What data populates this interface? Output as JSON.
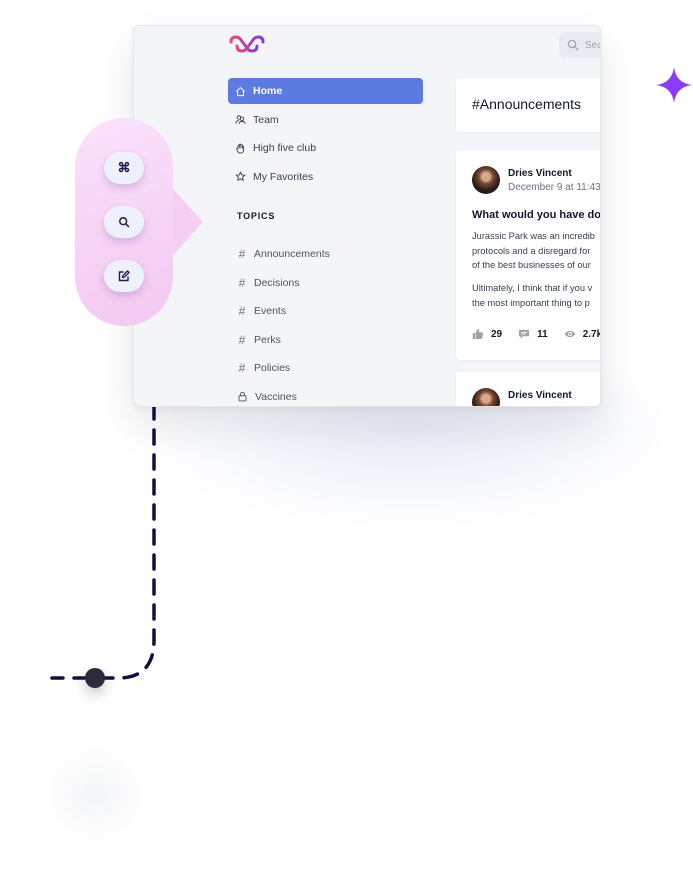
{
  "brand": {
    "logo_icon": "heart-chain-logo",
    "accent": "#5b7be0",
    "sparkle_color": "#8b3cf7"
  },
  "search": {
    "placeholder": "Sea",
    "icon": "search-icon"
  },
  "nav": {
    "items": [
      {
        "label": "Home",
        "icon": "home-icon",
        "active": true
      },
      {
        "label": "Team",
        "icon": "team-icon"
      },
      {
        "label": "High five club",
        "icon": "hand-icon"
      },
      {
        "label": "My Favorites",
        "icon": "star-icon"
      }
    ]
  },
  "topics": {
    "heading": "TOPICS",
    "items": [
      {
        "label": "Announcements",
        "icon": "hash"
      },
      {
        "label": "Decisions",
        "icon": "hash"
      },
      {
        "label": "Events",
        "icon": "hash"
      },
      {
        "label": "Perks",
        "icon": "hash"
      },
      {
        "label": "Policies",
        "icon": "hash"
      },
      {
        "label": "Vaccines",
        "icon": "lock-icon"
      }
    ]
  },
  "channel": {
    "title": "#Announcements"
  },
  "posts": [
    {
      "author": "Dries Vincent",
      "date": "December 9 at 11:43",
      "title": "What would you have dor",
      "body_lines": [
        "Jurassic Park was an incredib",
        "protocols and a disregard for",
        "of the best businesses of our"
      ],
      "body2_lines": [
        "Ultimately, I think that if you v",
        "the most important thing to p"
      ],
      "likes": "29",
      "comments": "11",
      "views": "2.7k"
    },
    {
      "author": "Dries Vincent"
    }
  ],
  "command_bubble": {
    "buttons": [
      {
        "label": "⌘",
        "icon": "command-icon"
      },
      {
        "icon": "search-icon"
      },
      {
        "icon": "edit-icon"
      }
    ]
  }
}
